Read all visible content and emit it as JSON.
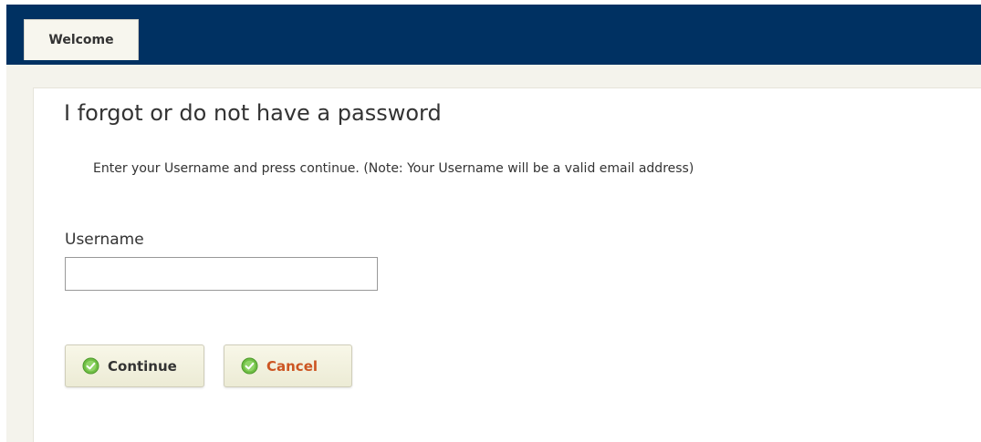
{
  "header": {
    "tab_label": "Welcome"
  },
  "main": {
    "title": "I forgot or do not have a password",
    "instruction": "Enter your Username and press continue. (Note: Your Username will be a valid email address)",
    "username_label": "Username",
    "username_value": "",
    "username_placeholder": ""
  },
  "actions": {
    "continue_label": "Continue",
    "cancel_label": "Cancel",
    "icon": "check-circle-icon"
  },
  "colors": {
    "header_bg": "#003162",
    "tab_bg": "#f7f6ee",
    "canvas_bg": "#f4f3ec",
    "button_bg": "#f3f2e0",
    "cancel_text": "#cc5522",
    "icon_green": "#6fbe44"
  }
}
